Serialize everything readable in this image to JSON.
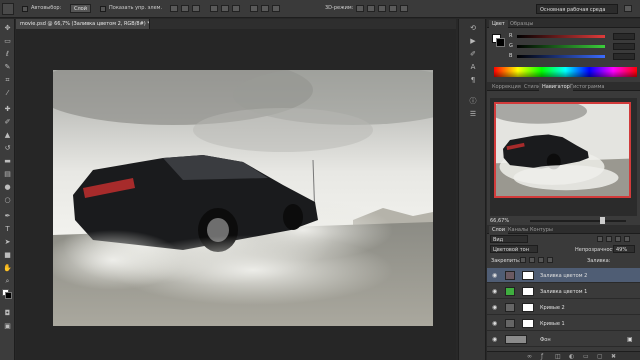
{
  "options_bar": {
    "auto_select_label": "Автовыбор:",
    "auto_select_value": "Слой",
    "show_controls_label": "Показать упр. элем.",
    "mode_3d_label": "3D-режим:",
    "workspace": "Основная рабочая среда"
  },
  "document": {
    "tab_title": "movie.psd @ 66,7% (Заливка цветом 2, RGB/8#) *",
    "close_glyph": "×"
  },
  "tools": {
    "icons": [
      "move-icon",
      "marquee-icon",
      "lasso-icon",
      "quick-select-icon",
      "crop-icon",
      "eyedropper-icon",
      "healing-icon",
      "brush-icon",
      "stamp-icon",
      "history-brush-icon",
      "eraser-icon",
      "gradient-icon",
      "blur-icon",
      "dodge-icon",
      "pen-icon",
      "type-icon",
      "path-select-icon",
      "shape-icon",
      "hand-icon",
      "zoom-icon"
    ]
  },
  "color_panel": {
    "tabs": [
      "Цвет",
      "Образцы"
    ],
    "active_tab": "Цвет",
    "channels": [
      {
        "label": "R",
        "color": "#e03b3b"
      },
      {
        "label": "G",
        "color": "#3bd03b"
      },
      {
        "label": "B",
        "color": "#3b6bff"
      }
    ]
  },
  "navigator_panel": {
    "tabs": [
      "Коррекция",
      "Стили",
      "Навигатор",
      "Гистограмма"
    ],
    "active_tab": "Навигатор",
    "zoom": "66,67%",
    "view_box_color": "#d23b3b"
  },
  "layers_panel": {
    "tabs": [
      "Слои",
      "Каналы",
      "Контуры"
    ],
    "active_tab": "Слои",
    "filter_kind": "Вид",
    "blend_mode": "Цветовой тон",
    "opacity_label": "Непрозрачность:",
    "opacity_value": "49%",
    "lock_label": "Закрепить:",
    "fill_label": "Заливка:",
    "layers": [
      {
        "name": "Заливка цветом 2",
        "selected": true,
        "thumb": "#6b5a62"
      },
      {
        "name": "Заливка цветом 1",
        "selected": false,
        "thumb": "#3fae3f"
      },
      {
        "name": "Кривые 2",
        "selected": false,
        "thumb": "#666666"
      },
      {
        "name": "Кривые 1",
        "selected": false,
        "thumb": "#666666"
      },
      {
        "name": "Фон",
        "selected": false,
        "thumb": "#8b8b8b"
      }
    ],
    "footer_icons": [
      "link-icon",
      "fx-icon",
      "mask-icon",
      "adjustment-icon",
      "group-icon",
      "new-layer-icon",
      "trash-icon"
    ]
  }
}
